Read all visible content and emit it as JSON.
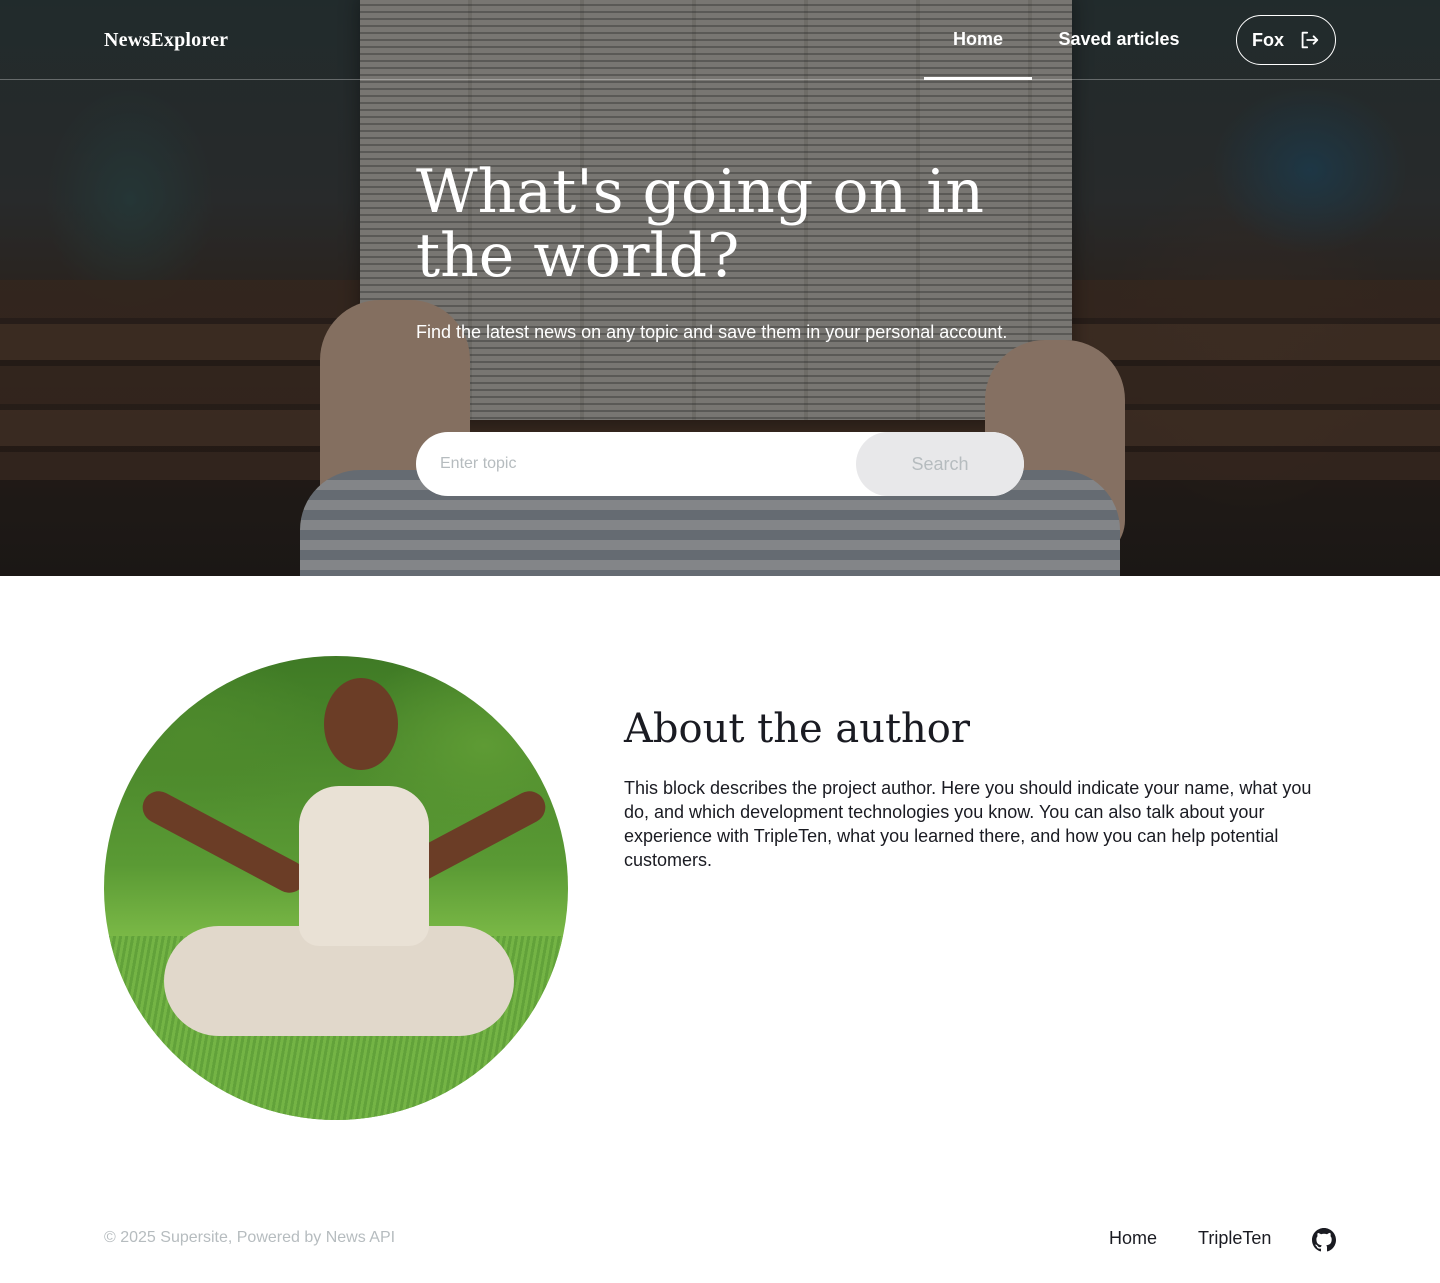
{
  "header": {
    "logo": "NewsExplorer",
    "nav": {
      "home_label": "Home",
      "saved_label": "Saved articles"
    },
    "user": {
      "name": "Fox",
      "logout_icon": "logout-icon"
    }
  },
  "hero": {
    "title": "What's going on in the world?",
    "subtitle": "Find the latest news on any topic and save them in your personal account.",
    "search": {
      "placeholder": "Enter topic",
      "value": "",
      "button_label": "Search"
    }
  },
  "about": {
    "title": "About the author",
    "text": "This block describes the project author. Here you should indicate your name, what you do, and which development technologies you know. You can also talk about your experience with TripleTen, what you learned there, and how you can help potential customers."
  },
  "footer": {
    "copyright": "© 2025 Supersite, Powered by News API",
    "links": {
      "home": "Home",
      "tripleten": "TripleTen"
    },
    "github_icon": "github-icon"
  },
  "colors": {
    "text_dark": "#1a1b22",
    "muted": "#b6bcbf",
    "button_bg": "#e8e8ea",
    "white": "#ffffff"
  }
}
